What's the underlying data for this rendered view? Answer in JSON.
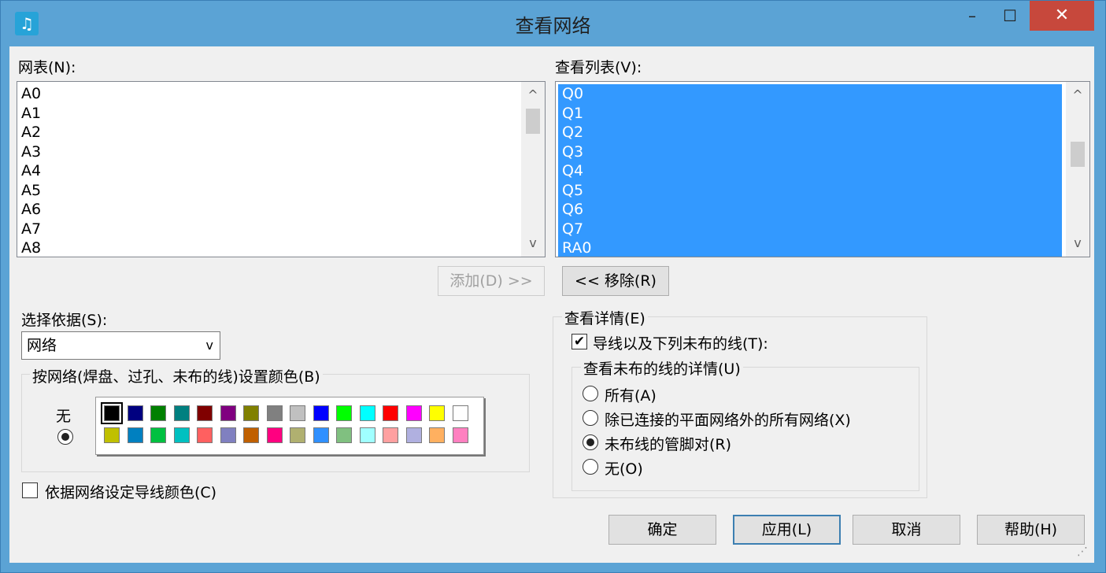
{
  "window": {
    "title": "查看网络",
    "min_glyph": "–",
    "max_glyph": "☐",
    "close_glyph": "✕",
    "app_icon_glyph": "♫"
  },
  "nets": {
    "label": "网表(N):",
    "items": [
      "A0",
      "A1",
      "A2",
      "A3",
      "A4",
      "A5",
      "A6",
      "A7",
      "A8"
    ]
  },
  "view_list": {
    "label": "查看列表(V):",
    "items": [
      "Q0",
      "Q1",
      "Q2",
      "Q3",
      "Q4",
      "Q5",
      "Q6",
      "Q7",
      "RA0"
    ]
  },
  "buttons": {
    "add": "添加(D) >>",
    "remove": "<< 移除(R)",
    "ok": "确定",
    "apply": "应用(L)",
    "cancel": "取消",
    "help": "帮助(H)"
  },
  "select_by": {
    "label": "选择依据(S):",
    "value": "网络"
  },
  "color_group": {
    "label": "按网络(焊盘、过孔、未布的线)设置颜色(B)",
    "none_label": "无",
    "none_selected": true,
    "colors_row1": [
      "#000000",
      "#000080",
      "#008000",
      "#008080",
      "#800000",
      "#800080",
      "#808000",
      "#808080",
      "#c0c0c0",
      "#0000ff",
      "#00ff00",
      "#00ffff",
      "#ff0000",
      "#ff00ff",
      "#ffff00",
      "#ffffff"
    ],
    "colors_row2": [
      "#c0c000",
      "#0080c0",
      "#00c040",
      "#00c0c0",
      "#ff6060",
      "#8080c0",
      "#c06000",
      "#ff0080",
      "#b0b070",
      "#3090ff",
      "#80c080",
      "#a0ffff",
      "#ffa0a0",
      "#b0b0e0",
      "#ffb060",
      "#ff80c0"
    ],
    "selected_index": 0
  },
  "trace_by_net": {
    "label": "依据网络设定导线颜色(C)",
    "checked": false
  },
  "view_detail": {
    "label": "查看详情(E)",
    "traces_label": "导线以及下列未布的线(T):",
    "traces_checked": true,
    "unrouted_group_label": "查看未布的线的详情(U)",
    "options": [
      "所有(A)",
      "除已连接的平面网络外的所有网络(X)",
      "未布线的管脚对(R)",
      "无(O)"
    ],
    "selected_option": 2
  },
  "icons": {
    "scroll_up": "^",
    "scroll_down": "v",
    "combo_arrow": "v",
    "check": "✔",
    "grip": "⋰"
  }
}
